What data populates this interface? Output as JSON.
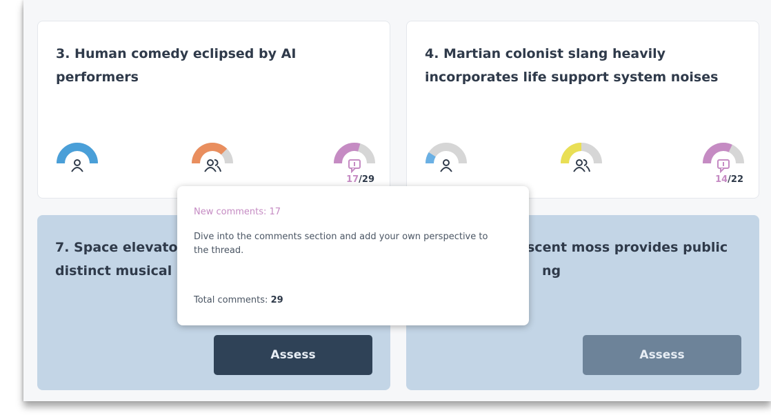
{
  "cards": [
    {
      "title": "3. Human comedy eclipsed by AI performers",
      "comments_new": "17",
      "comments_sep": "/",
      "comments_total": "29",
      "gauges": [
        {
          "icon": "person-icon",
          "color": "#4a9fd8",
          "level": 1.0
        },
        {
          "icon": "group-icon",
          "color": "#e98e5e",
          "level": 0.75
        },
        {
          "icon": "comment-icon",
          "color": "#c58bc3",
          "level": 0.59
        }
      ]
    },
    {
      "title": "4. Martian colonist slang heavily incorporates life support system noises",
      "comments_new": "14",
      "comments_sep": "/",
      "comments_total": "22",
      "gauges": [
        {
          "icon": "person-icon",
          "color": "#6ab0e4",
          "level": 0.18
        },
        {
          "icon": "group-icon",
          "color": "#e9df55",
          "level": 0.5
        },
        {
          "icon": "comment-icon",
          "color": "#c58bc3",
          "level": 0.64
        }
      ]
    },
    {
      "title_line1": "7. Space elevato",
      "title_line2": "distinct musical",
      "button": "Assess"
    },
    {
      "title_line1": "scent moss provides public",
      "title_line2": "ng",
      "button": "Assess"
    }
  ],
  "tooltip": {
    "new_comments": "New comments: 17",
    "body": "Dive into the comments section and add your own perspective to the thread.",
    "total_label": "Total comments:",
    "total_value": "29"
  },
  "colors": {
    "track": "#d6d6d6",
    "new_comment": "#c58bc3",
    "assess_dark": "#2f4257",
    "assess_gray": "#6d8399",
    "card_blue": "#c3d5e6"
  }
}
